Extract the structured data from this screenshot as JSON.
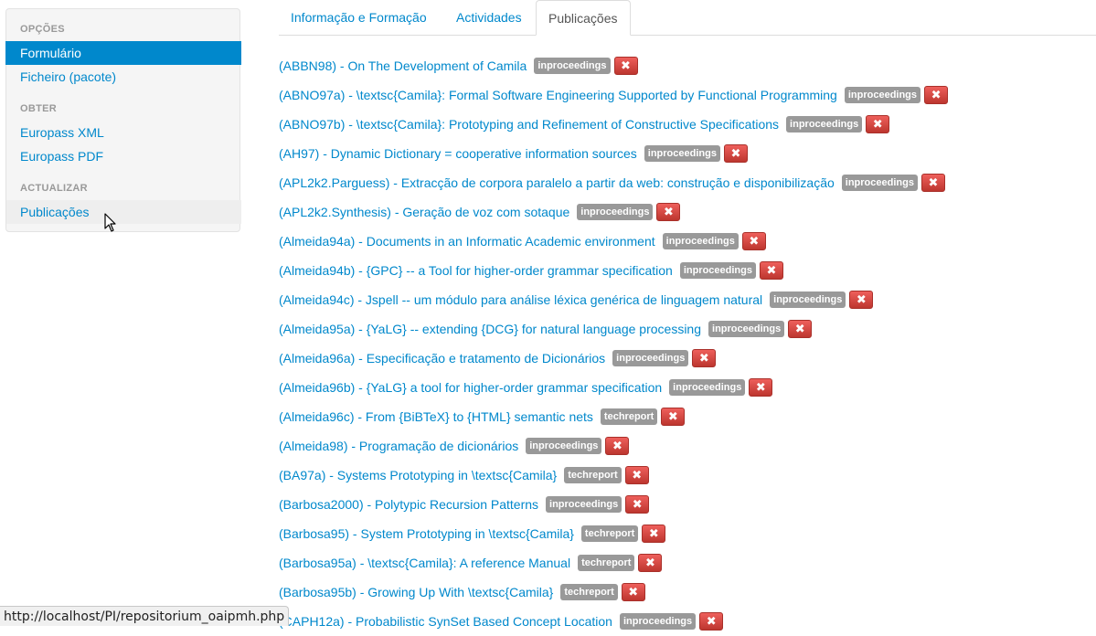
{
  "sidebar": {
    "sections": [
      {
        "header": "OPÇÕES",
        "items": [
          "Formulário",
          "Ficheiro (pacote)"
        ]
      },
      {
        "header": "OBTER",
        "items": [
          "Europass XML",
          "Europass PDF"
        ]
      },
      {
        "header": "ACTUALIZAR",
        "items": [
          "Publicações"
        ]
      }
    ],
    "active_item": "Formulário",
    "hover_item": "Publicações"
  },
  "tabs": {
    "items": [
      "Informação e Formação",
      "Actividades",
      "Publicações"
    ],
    "active": "Publicações"
  },
  "delete_icon": "close-icon",
  "publications": [
    {
      "title": "(ABBN98) - On The Development of Camila",
      "type": "inproceedings"
    },
    {
      "title": "(ABNO97a) - \\textsc{Camila}: Formal Software Engineering Supported by Functional Programming",
      "type": "inproceedings"
    },
    {
      "title": "(ABNO97b) - \\textsc{Camila}: Prototyping and Refinement of Constructive Specifications",
      "type": "inproceedings"
    },
    {
      "title": "(AH97) - Dynamic Dictionary = cooperative information sources",
      "type": "inproceedings"
    },
    {
      "title": "(APL2k2.Parguess) - Extracção de corpora paralelo a partir da web: construção e disponibilização",
      "type": "inproceedings"
    },
    {
      "title": "(APL2k2.Synthesis) - Geração de voz com sotaque",
      "type": "inproceedings"
    },
    {
      "title": "(Almeida94a) - Documents in an Informatic Academic environment",
      "type": "inproceedings"
    },
    {
      "title": "(Almeida94b) - {GPC} -- a Tool for higher-order grammar specification",
      "type": "inproceedings"
    },
    {
      "title": "(Almeida94c) - Jspell -- um módulo para análise léxica genérica de linguagem natural",
      "type": "inproceedings"
    },
    {
      "title": "(Almeida95a) - {YaLG} -- extending {DCG} for natural language processing",
      "type": "inproceedings"
    },
    {
      "title": "(Almeida96a) - Especificação e tratamento de Dicionários",
      "type": "inproceedings"
    },
    {
      "title": "(Almeida96b) - {YaLG} a tool for higher-order grammar specification",
      "type": "inproceedings"
    },
    {
      "title": "(Almeida96c) - From {BiBTeX} to {HTML} semantic nets",
      "type": "techreport"
    },
    {
      "title": "(Almeida98) - Programação de dicionários",
      "type": "inproceedings"
    },
    {
      "title": "(BA97a) - Systems Prototyping in \\textsc{Camila}",
      "type": "techreport"
    },
    {
      "title": "(Barbosa2000) - Polytypic Recursion Patterns",
      "type": "inproceedings"
    },
    {
      "title": "(Barbosa95) - System Prototyping in \\textsc{Camila}",
      "type": "techreport"
    },
    {
      "title": "(Barbosa95a) - \\textsc{Camila}: A reference Manual",
      "type": "techreport"
    },
    {
      "title": "(Barbosa95b) - Growing Up With \\textsc{Camila}",
      "type": "techreport"
    },
    {
      "title": "(CAPH12a) - Probabilistic SynSet Based Concept Location",
      "type": "inproceedings"
    }
  ],
  "statusbar": {
    "url": "http://localhost/PI/repositorium_oaipmh.php"
  }
}
